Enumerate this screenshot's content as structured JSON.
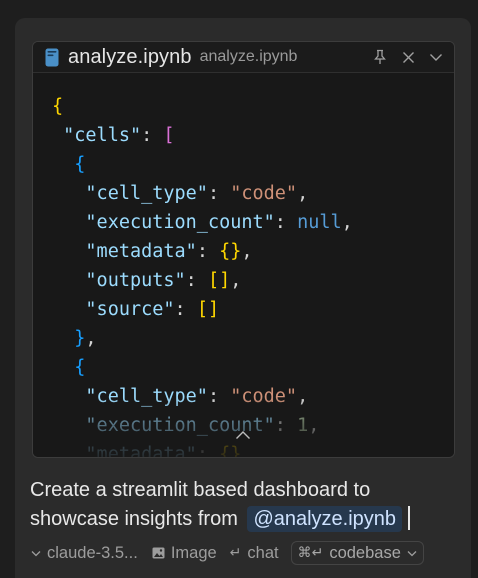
{
  "editor": {
    "file_name": "analyze.ipynb",
    "file_path": "analyze.ipynb",
    "icons": {
      "file": "notebook-file-icon",
      "pin": "pin-icon",
      "close": "close-icon",
      "collapse": "chevron-down-icon"
    },
    "code_lines": [
      [
        {
          "t": "{",
          "c": "tok-brace"
        }
      ],
      [
        {
          "t": " ",
          "c": ""
        },
        {
          "t": "\"cells\"",
          "c": "tok-key"
        },
        {
          "t": ": ",
          "c": "tok-punct"
        },
        {
          "t": "[",
          "c": "tok-bracket"
        }
      ],
      [
        {
          "t": "  ",
          "c": ""
        },
        {
          "t": "{",
          "c": "tok-brace2"
        }
      ],
      [
        {
          "t": "   ",
          "c": ""
        },
        {
          "t": "\"cell_type\"",
          "c": "tok-key"
        },
        {
          "t": ": ",
          "c": "tok-punct"
        },
        {
          "t": "\"code\"",
          "c": "tok-str"
        },
        {
          "t": ",",
          "c": "tok-punct"
        }
      ],
      [
        {
          "t": "   ",
          "c": ""
        },
        {
          "t": "\"execution_count\"",
          "c": "tok-key"
        },
        {
          "t": ": ",
          "c": "tok-punct"
        },
        {
          "t": "null",
          "c": "tok-null"
        },
        {
          "t": ",",
          "c": "tok-punct"
        }
      ],
      [
        {
          "t": "   ",
          "c": ""
        },
        {
          "t": "\"metadata\"",
          "c": "tok-key"
        },
        {
          "t": ": ",
          "c": "tok-punct"
        },
        {
          "t": "{}",
          "c": "tok-brace"
        },
        {
          "t": ",",
          "c": "tok-punct"
        }
      ],
      [
        {
          "t": "   ",
          "c": ""
        },
        {
          "t": "\"outputs\"",
          "c": "tok-key"
        },
        {
          "t": ": ",
          "c": "tok-punct"
        },
        {
          "t": "[]",
          "c": "tok-brace"
        },
        {
          "t": ",",
          "c": "tok-punct"
        }
      ],
      [
        {
          "t": "   ",
          "c": ""
        },
        {
          "t": "\"source\"",
          "c": "tok-key"
        },
        {
          "t": ": ",
          "c": "tok-punct"
        },
        {
          "t": "[]",
          "c": "tok-brace"
        }
      ],
      [
        {
          "t": "  ",
          "c": ""
        },
        {
          "t": "}",
          "c": "tok-brace2"
        },
        {
          "t": ",",
          "c": "tok-punct"
        }
      ],
      [
        {
          "t": "  ",
          "c": ""
        },
        {
          "t": "{",
          "c": "tok-brace2"
        }
      ],
      [
        {
          "t": "   ",
          "c": ""
        },
        {
          "t": "\"cell_type\"",
          "c": "tok-key"
        },
        {
          "t": ": ",
          "c": "tok-punct"
        },
        {
          "t": "\"code\"",
          "c": "tok-str"
        },
        {
          "t": ",",
          "c": "tok-punct"
        }
      ],
      [
        {
          "t": "   ",
          "c": ""
        },
        {
          "t": "\"execution_count\"",
          "c": "tok-key"
        },
        {
          "t": ": ",
          "c": "tok-punct"
        },
        {
          "t": "1",
          "c": "tok-num"
        },
        {
          "t": ",",
          "c": "tok-punct"
        }
      ],
      [
        {
          "t": "   ",
          "c": ""
        },
        {
          "t": "\"metadata\"",
          "c": "tok-key"
        },
        {
          "t": ": ",
          "c": "tok-punct"
        },
        {
          "t": "{}",
          "c": "tok-brace"
        },
        {
          "t": ",",
          "c": "tok-punct"
        }
      ]
    ]
  },
  "prompt": {
    "text": "Create a streamlit based dashboard to showcase insights from",
    "mention": "@analyze.ipynb"
  },
  "toolbar": {
    "model_label": "claude-3.5...",
    "image_label": "Image",
    "chat_label": "chat",
    "chat_shortcut": "↵",
    "codebase_label": "codebase",
    "codebase_shortcut": "⌘↵"
  },
  "colors": {
    "panel": "#2b2b2b",
    "editor_bg": "#181818",
    "key": "#9cdcfe",
    "string": "#ce9178",
    "keyword": "#569cd6",
    "brace": "#ffd700",
    "bracket": "#da70d6",
    "inner_brace": "#179fff",
    "mention_bg": "#26384d"
  }
}
